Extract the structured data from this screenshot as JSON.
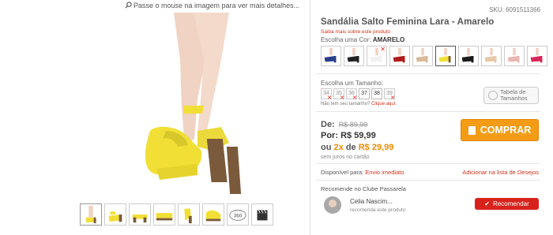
{
  "gallery": {
    "hint": "Passe o mouse na imagem para ver mais detalhes...",
    "thumbnails": [
      "thumb-1",
      "thumb-2",
      "thumb-3",
      "thumb-4",
      "thumb-5",
      "thumb-6",
      "360",
      "video"
    ],
    "thumb_360_label": "FOTO 360"
  },
  "product": {
    "sku": "SKU: 6091511366",
    "title": "Sandália Salto Feminina Lara - Amarelo",
    "more_info": "Saiba mais sobre este produto",
    "color_label": "Escolha uma Cor:",
    "color_value": "AMARELO",
    "size_label": "Escolha um Tamanho:",
    "sizes": [
      {
        "value": "34",
        "available": false
      },
      {
        "value": "35",
        "available": false
      },
      {
        "value": "36",
        "available": false
      },
      {
        "value": "37",
        "available": true
      },
      {
        "value": "38",
        "available": true
      },
      {
        "value": "39",
        "available": false
      }
    ],
    "no_size_text": "Não tem seu tamanho?",
    "no_size_link": "Clique aqui.",
    "size_table_btn_line1": "Tabela de",
    "size_table_btn_line2": "Tamanhos"
  },
  "swatches": [
    {
      "name": "azul",
      "color": "#2a3f8a",
      "selected": false,
      "unavailable": false
    },
    {
      "name": "preto",
      "color": "#222222",
      "selected": false,
      "unavailable": false
    },
    {
      "name": "branco",
      "color": "#f1f1f1",
      "selected": false,
      "unavailable": true
    },
    {
      "name": "vermelho",
      "color": "#b01c1c",
      "selected": false,
      "unavailable": false
    },
    {
      "name": "nude",
      "color": "#d9b99b",
      "selected": false,
      "unavailable": false
    },
    {
      "name": "amarelo",
      "color": "#f2df35",
      "selected": true,
      "unavailable": false
    },
    {
      "name": "preto-verniz",
      "color": "#1a1a1a",
      "selected": false,
      "unavailable": false
    },
    {
      "name": "bege",
      "color": "#e6c9a8",
      "selected": false,
      "unavailable": false
    },
    {
      "name": "rosa",
      "color": "#e9b6b2",
      "selected": false,
      "unavailable": false
    },
    {
      "name": "pink",
      "color": "#d8285a",
      "selected": false,
      "unavailable": false
    }
  ],
  "price": {
    "de_label": "De:",
    "de_value": "R$ 89,99",
    "por_label": "Por:",
    "por_value": "R$ 59,99",
    "parcel_prefix": "ou",
    "parcel_count": "2x",
    "parcel_de": "de",
    "parcel_value": "R$ 29,99",
    "juros": "sem juros no cartão",
    "buy_label": "COMPRAR"
  },
  "availability": {
    "label": "Disponível para:",
    "value": "Envio imediato",
    "wishlist": "Adicionar na lista de Desejos"
  },
  "recommend": {
    "label": "Recomende no Clube Passarela",
    "user_name": "Celia Nascim...",
    "user_sub": "recomenda este produto",
    "button": "Recomendar"
  },
  "colors": {
    "accent_orange": "#f49c16",
    "link_red": "#d0311b",
    "button_red": "#d8221c",
    "shoe_yellow": "#f2df35"
  }
}
